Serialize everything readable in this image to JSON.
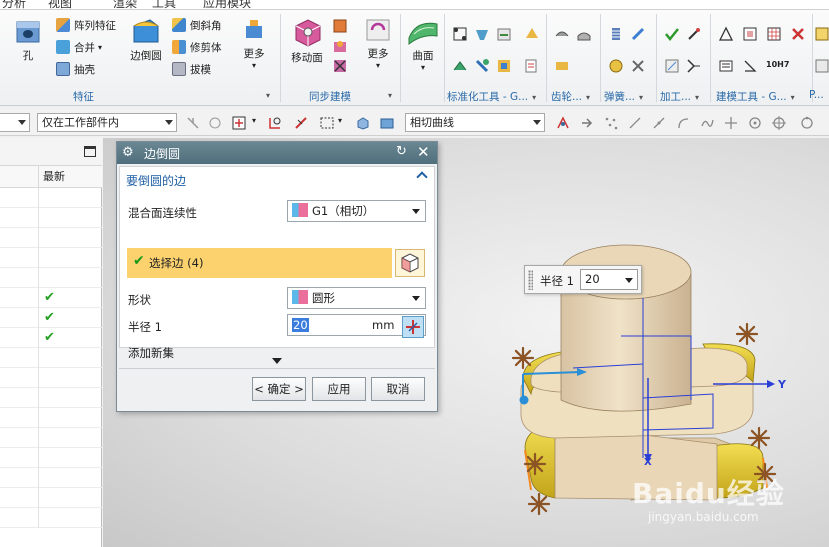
{
  "menubar": {
    "items": [
      "分析",
      "视图",
      "渲染",
      "工具",
      "应用模块"
    ]
  },
  "ribbon": {
    "hole_label": "孔",
    "array_feature": "阵列特征",
    "combine": "合并",
    "shell": "抽壳",
    "edge_blend": "边倒圆",
    "chamfer": "倒斜角",
    "trim_body": "修剪体",
    "draft": "拔模",
    "more_1": "更多",
    "move_face": "移动面",
    "more_2": "更多",
    "surface": "曲面",
    "groups": {
      "feature": "特征",
      "sync_model": "同步建模",
      "std_tools": "标准化工具 - G...",
      "gear": "齿轮...",
      "spring": "弹簧...",
      "machining": "加工...",
      "modeling_tools": "建模工具 - G...",
      "more": "P..."
    },
    "badge_10h7": "10H7"
  },
  "toolbar2": {
    "filter_scope": "仅在工作部件内",
    "curve_rule": "相切曲线"
  },
  "navigator": {
    "column_latest": "最新",
    "row_count": 17,
    "checked_rows": [
      5,
      6,
      7
    ]
  },
  "dialog": {
    "title": "边倒圆",
    "section_title": "要倒圆的边",
    "continuity_label": "混合面连续性",
    "continuity_value": "G1（相切）",
    "select_edge_label": "选择边 (4)",
    "shape_label": "形状",
    "shape_value": "圆形",
    "radius_label": "半径 1",
    "radius_value": "20",
    "radius_unit": "mm",
    "add_set_label": "添加新集",
    "ok_button": "< 确定 >",
    "apply_button": "应用",
    "cancel_button": "取消"
  },
  "radius_float": {
    "label": "半径 1",
    "value": "20"
  },
  "axes": {
    "x": "X",
    "y": "Y"
  },
  "watermark": {
    "main": "Baidu经验",
    "sub": "jingyan.baidu.com"
  },
  "colors": {
    "title_bar": "#5b7a87",
    "highlight_row": "#fcd26f",
    "section_header": "#1f5fa3",
    "fillet_yellow": "#d7b927",
    "body_beige": "#e6d3b6"
  }
}
